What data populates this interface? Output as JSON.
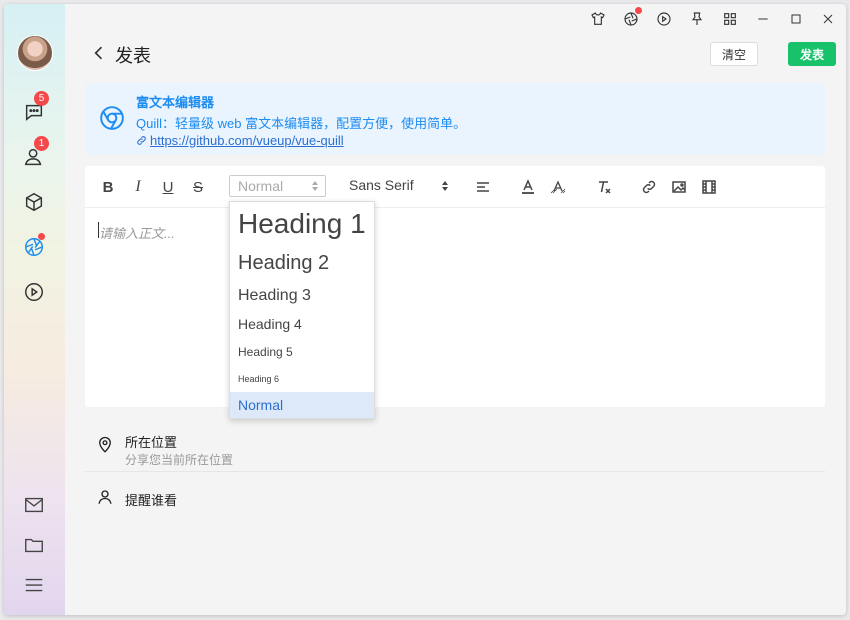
{
  "sidebar": {
    "badges": {
      "chat": "5",
      "contacts": "1"
    },
    "icons": [
      "chat-icon",
      "contacts-icon",
      "cube-icon",
      "aperture-icon",
      "play-icon",
      "mail-icon",
      "folder-icon",
      "menu-icon"
    ]
  },
  "topbar": {
    "icons": [
      "shirt-icon",
      "aperture-icon",
      "play-circle-icon",
      "pin-icon",
      "grid-icon",
      "minimize-icon",
      "maximize-icon",
      "close-icon"
    ]
  },
  "header": {
    "title": "发表",
    "clear_label": "清空",
    "publish_label": "发表"
  },
  "info": {
    "title": "富文本编辑器",
    "description": "Quill：轻量级 web 富文本编辑器，配置方便，使用简单。",
    "link": " https://github.com/vueup/vue-quill"
  },
  "editor": {
    "toolbar": {
      "bold": "B",
      "italic": "I",
      "underline": "U",
      "strike": "S",
      "header_value": "Normal",
      "font_value": "Sans Serif"
    },
    "placeholder": "请输入正文...",
    "header_options": [
      "Heading 1",
      "Heading 2",
      "Heading 3",
      "Heading 4",
      "Heading 5",
      "Heading 6",
      "Normal"
    ]
  },
  "location": {
    "title": "所在位置",
    "subtitle": "分享您当前所在位置"
  },
  "remind": {
    "title": "提醒谁看"
  },
  "colors": {
    "accent": "#18c26a",
    "link": "#1d8cf0",
    "badge": "#f5484a"
  }
}
